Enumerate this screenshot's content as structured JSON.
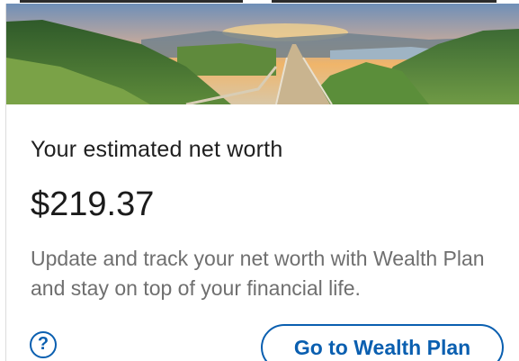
{
  "net_worth_card": {
    "hero_image": "mountain-valley-trail-landscape",
    "title": "Your estimated net worth",
    "amount": "$219.37",
    "description": "Update and track your net worth with Wealth Plan and stay on top of your financial life.",
    "help_icon": "?",
    "cta_label": "Go to Wealth Plan"
  },
  "colors": {
    "accent": "#0a5fb0",
    "title_text": "#1f1f1f",
    "body_text": "#6f6f6f",
    "background": "#ffffff"
  }
}
